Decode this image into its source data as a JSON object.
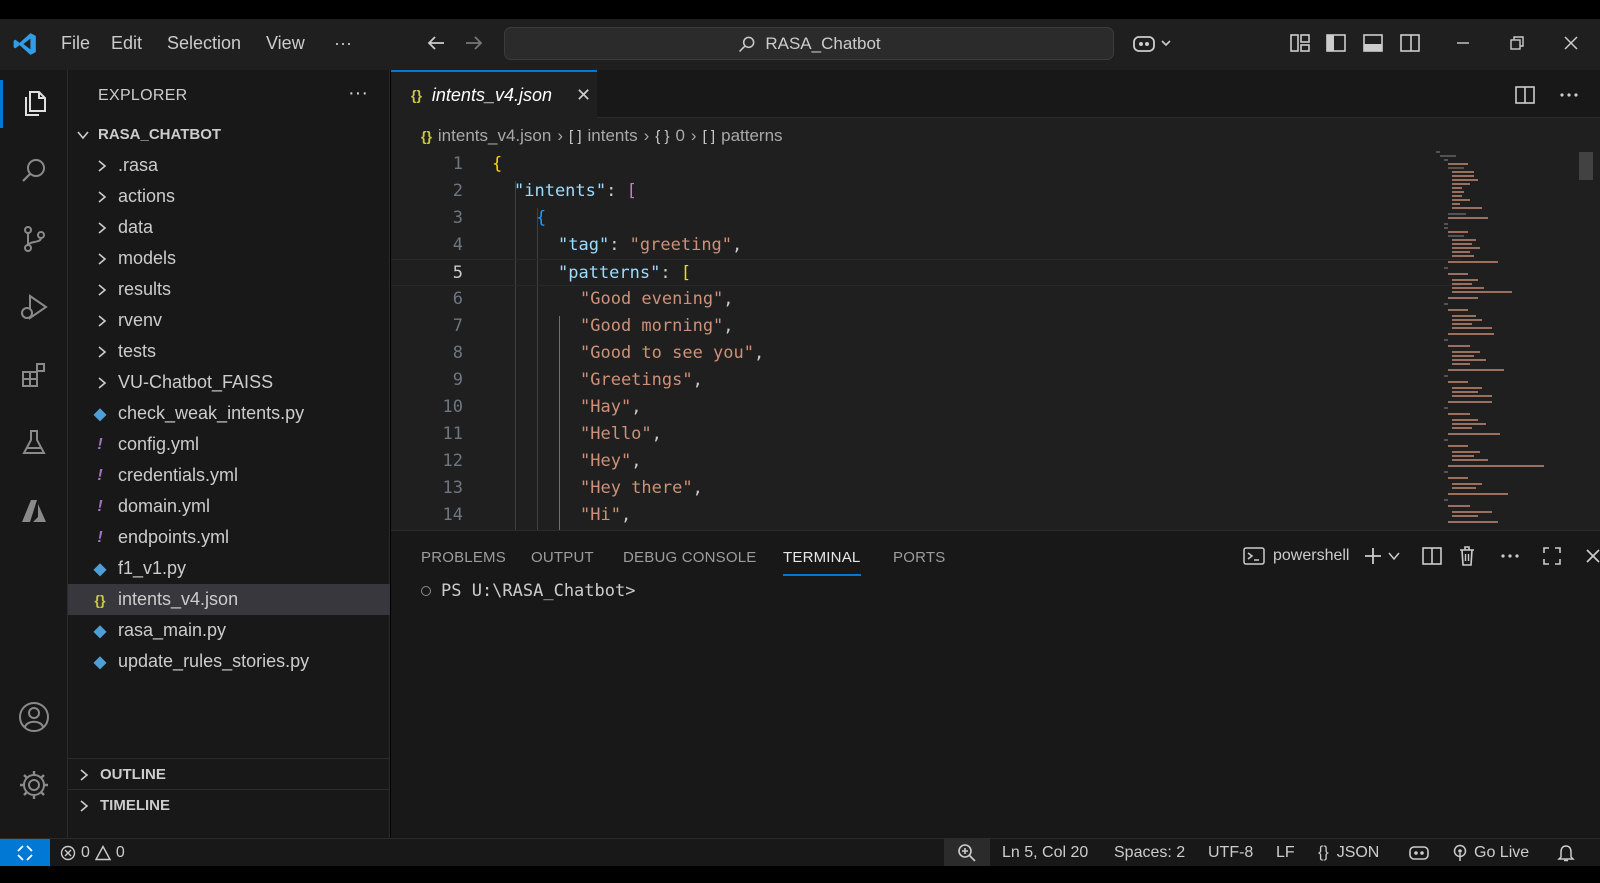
{
  "titlebar": {
    "menu": [
      "File",
      "Edit",
      "Selection",
      "View",
      "···"
    ],
    "search_text": "RASA_Chatbot"
  },
  "sidebar": {
    "title": "EXPLORER",
    "more": "···",
    "root": "RASA_CHATBOT",
    "items": [
      {
        "label": ".rasa",
        "type": "folder"
      },
      {
        "label": "actions",
        "type": "folder"
      },
      {
        "label": "data",
        "type": "folder"
      },
      {
        "label": "models",
        "type": "folder"
      },
      {
        "label": "results",
        "type": "folder"
      },
      {
        "label": "rvenv",
        "type": "folder"
      },
      {
        "label": "tests",
        "type": "folder"
      },
      {
        "label": "VU-Chatbot_FAISS",
        "type": "folder"
      },
      {
        "label": "check_weak_intents.py",
        "type": "py"
      },
      {
        "label": "config.yml",
        "type": "yml"
      },
      {
        "label": "credentials.yml",
        "type": "yml"
      },
      {
        "label": "domain.yml",
        "type": "yml"
      },
      {
        "label": "endpoints.yml",
        "type": "yml"
      },
      {
        "label": "f1_v1.py",
        "type": "py"
      },
      {
        "label": "intents_v4.json",
        "type": "json",
        "selected": true
      },
      {
        "label": "rasa_main.py",
        "type": "py"
      },
      {
        "label": "update_rules_stories.py",
        "type": "py"
      }
    ],
    "outline": "OUTLINE",
    "timeline": "TIMELINE"
  },
  "editor": {
    "tab_label": "intents_v4.json",
    "breadcrumb": [
      "intents_v4.json",
      "intents",
      "0",
      "patterns"
    ],
    "current_line": 5
  },
  "code_lines": [
    {
      "n": "1",
      "indent": 0,
      "parts": [
        [
          "b1",
          "{"
        ]
      ]
    },
    {
      "n": "2",
      "indent": 1,
      "parts": [
        [
          "k",
          "\"intents\""
        ],
        [
          "p",
          ": "
        ],
        [
          "b2",
          "["
        ]
      ]
    },
    {
      "n": "3",
      "indent": 2,
      "parts": [
        [
          "b3",
          "{"
        ]
      ]
    },
    {
      "n": "4",
      "indent": 3,
      "parts": [
        [
          "k",
          "\"tag\""
        ],
        [
          "p",
          ": "
        ],
        [
          "s",
          "\"greeting\""
        ],
        [
          "p",
          ","
        ]
      ]
    },
    {
      "n": "5",
      "indent": 3,
      "parts": [
        [
          "k",
          "\"patterns\""
        ],
        [
          "p",
          ": "
        ],
        [
          "b1",
          "["
        ]
      ]
    },
    {
      "n": "6",
      "indent": 4,
      "parts": [
        [
          "s",
          "\"Good evening\""
        ],
        [
          "p",
          ","
        ]
      ]
    },
    {
      "n": "7",
      "indent": 4,
      "parts": [
        [
          "s",
          "\"Good morning\""
        ],
        [
          "p",
          ","
        ]
      ]
    },
    {
      "n": "8",
      "indent": 4,
      "parts": [
        [
          "s",
          "\"Good to see you\""
        ],
        [
          "p",
          ","
        ]
      ]
    },
    {
      "n": "9",
      "indent": 4,
      "parts": [
        [
          "s",
          "\"Greetings\""
        ],
        [
          "p",
          ","
        ]
      ]
    },
    {
      "n": "10",
      "indent": 4,
      "parts": [
        [
          "s",
          "\"Hay\""
        ],
        [
          "p",
          ","
        ]
      ]
    },
    {
      "n": "11",
      "indent": 4,
      "parts": [
        [
          "s",
          "\"Hello\""
        ],
        [
          "p",
          ","
        ]
      ]
    },
    {
      "n": "12",
      "indent": 4,
      "parts": [
        [
          "s",
          "\"Hey\""
        ],
        [
          "p",
          ","
        ]
      ]
    },
    {
      "n": "13",
      "indent": 4,
      "parts": [
        [
          "s",
          "\"Hey there\""
        ],
        [
          "p",
          ","
        ]
      ]
    },
    {
      "n": "14",
      "indent": 4,
      "parts": [
        [
          "s",
          "\"Hi\""
        ],
        [
          "p",
          ","
        ]
      ]
    }
  ],
  "panel": {
    "tabs": [
      "PROBLEMS",
      "OUTPUT",
      "DEBUG CONSOLE",
      "TERMINAL",
      "PORTS"
    ],
    "active_tab": "TERMINAL",
    "shell": "powershell",
    "prompt": "PS U:\\RASA_Chatbot>"
  },
  "statusbar": {
    "errors": "0",
    "warnings": "0",
    "position": "Ln 5, Col 20",
    "spaces": "Spaces: 2",
    "encoding": "UTF-8",
    "eol": "LF",
    "language": "JSON",
    "golive": "Go Live"
  },
  "colors": {
    "accent": "#0078d4",
    "json_key": "#9cdcfe",
    "json_string": "#ce9178"
  }
}
